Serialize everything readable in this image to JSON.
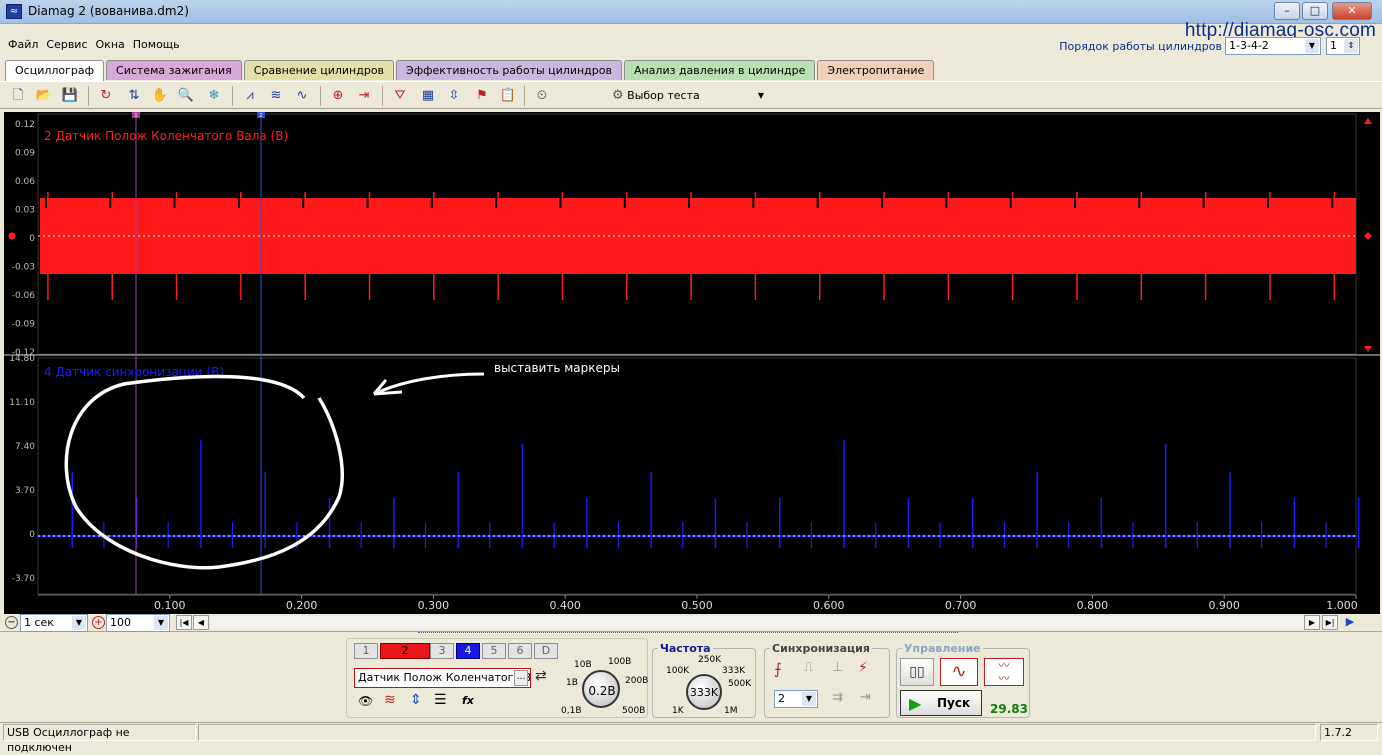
{
  "window": {
    "title": "Diamag 2 (вованива.dm2)",
    "url": "http://diamag-osc.com",
    "minimize": "–",
    "maximize": "□",
    "close": "✕"
  },
  "menu": [
    "Файл",
    "Сервис",
    "Окна",
    "Помощь"
  ],
  "firing_order": {
    "label": "Порядок работы цилиндров",
    "value": "1-3-4-2",
    "cyl": "1"
  },
  "tabs": [
    {
      "label": "Осциллограф",
      "color": "#ffffff",
      "active": true
    },
    {
      "label": "Система зажигания",
      "color": "#d8a8d8"
    },
    {
      "label": "Сравнение цилиндров",
      "color": "#e0e0a8"
    },
    {
      "label": "Эффективность работы цилиндров",
      "color": "#c8b8e0"
    },
    {
      "label": "Анализ давления в цилиндре",
      "color": "#b8e0b0"
    },
    {
      "label": "Электропитание",
      "color": "#f0d0b8"
    }
  ],
  "toolbar": {
    "test_select": "Выбор теста",
    "icons": [
      "new-icon",
      "open-icon",
      "save-icon",
      "loop-icon",
      "cursor-icon",
      "hand-icon",
      "zoom-icon",
      "filter-icon",
      "signal-a-icon",
      "signal-b-icon",
      "signal-c-icon",
      "auto-scale-icon",
      "zero-icon",
      "marker-icon",
      "table-icon",
      "split-icon",
      "flag-icon",
      "notes-icon",
      "auto-icon"
    ]
  },
  "scope": {
    "marker1": "1",
    "marker2": "2",
    "ch2": {
      "label": "2 Датчик Полож Коленчатого Вала (В)",
      "color": "#ff1a1a",
      "ticks": [
        "0.12",
        "0.09",
        "0.06",
        "0.03",
        "0",
        "-0.03",
        "-0.06",
        "-0.09",
        "-0.12"
      ]
    },
    "ch4": {
      "label": "4 Датчик синхронизации (В)",
      "color": "#1a1aff",
      "ticks": [
        "14.80",
        "11.10",
        "7.40",
        "3.70",
        "0",
        "-3.70"
      ]
    },
    "xticks": [
      "0.100",
      "0.200",
      "0.300",
      "0.400",
      "0.500",
      "0.600",
      "0.700",
      "0.800",
      "0.900",
      "1.000"
    ],
    "annotation": "выставить маркеры"
  },
  "timebar": {
    "time_value": "1 сек",
    "zoom_value": "100"
  },
  "channels": {
    "buttons": [
      "1",
      "2",
      "3",
      "4",
      "5",
      "6",
      "D"
    ],
    "active": [
      {
        "label": "2",
        "color": "#e8161b"
      },
      {
        "label": "4",
        "color": "#1818e0"
      }
    ],
    "sensor_select": "Датчик Полож Коленчатого Ва",
    "volt_knob": {
      "value": "0.2В",
      "labels": [
        "10В",
        "100В",
        "1В",
        "200В",
        "0,1В",
        "500В"
      ]
    }
  },
  "frequency": {
    "title": "Частота",
    "value": "333K",
    "labels": [
      "250K",
      "100K",
      "333K",
      "500K",
      "1K",
      "1M"
    ]
  },
  "sync": {
    "title": "Синхронизация",
    "channel": "2"
  },
  "control": {
    "title": "Управление",
    "start": "Пуск",
    "fps": "29.83"
  },
  "status": {
    "text": "USB Осциллограф не подключен",
    "version": "1.7.2"
  }
}
